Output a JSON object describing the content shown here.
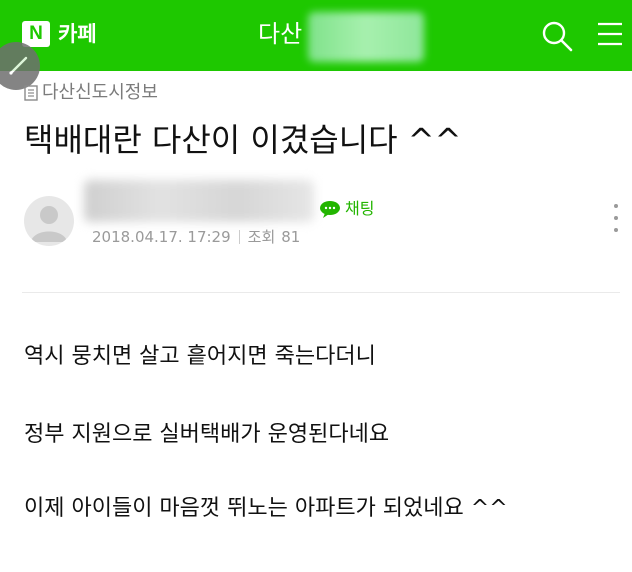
{
  "header": {
    "logo_letter": "N",
    "service_label": "카페",
    "cafe_name_visible": "다산"
  },
  "post": {
    "board_name": "다산신도시정보",
    "title": "택배대란 다산이 이겼습니다 ^^",
    "chat_label": "채팅",
    "date": "2018.04.17. 17:29",
    "views_label": "조회",
    "views_count": "81",
    "body": [
      "역시 뭉치면 살고 흩어지면 죽는다더니",
      "정부 지원으로 실버택배가 운영된다네요",
      "이제 아이들이 마음껏 뛰노는 아파트가 되었네요 ^^"
    ]
  },
  "colors": {
    "brand_green": "#1ec800",
    "chat_green": "#23b500"
  },
  "icons": [
    "search-icon",
    "menu-icon",
    "pencil-icon",
    "board-icon",
    "chat-icon",
    "more-icon"
  ]
}
